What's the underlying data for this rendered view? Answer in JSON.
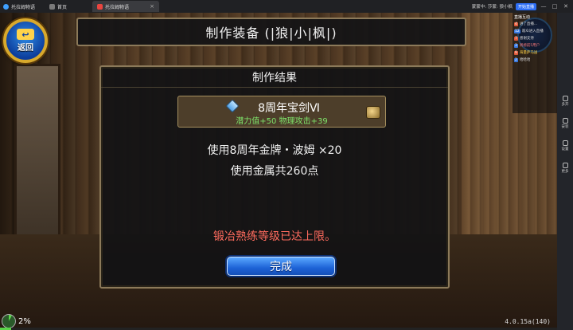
{
  "browser": {
    "app_tab": "托拉姆物语",
    "tabs": [
      {
        "label": "首页"
      },
      {
        "label": "托拉姆物语"
      }
    ],
    "live_label": "蒙蒙中: 莎蒙: 狼小枫",
    "live_pill": "开始直播",
    "win_controls": [
      "—",
      "□",
      "✕"
    ]
  },
  "game": {
    "back_button_label": "返回",
    "title": "制作装备 (|狼|小|枫|)",
    "dialog_title": "制作结果",
    "item": {
      "name": "8周年宝剑Ⅵ",
      "stats": "潜力值+50 物理攻击+39",
      "icon": "sword-icon"
    },
    "material_line": "使用8周年金牌・波姆 ×20",
    "metal_line": "使用金属共260点",
    "warning": "锻冶熟练等级已达上限。",
    "done_button": "完成",
    "progress_pct": "2%",
    "progress_fraction": 0.02,
    "version": "4.0.15a(140)"
  },
  "sidebar": {
    "tools": [
      {
        "label": "多开"
      },
      {
        "label": "安装"
      },
      {
        "label": "设置"
      },
      {
        "label": "更多"
      }
    ]
  },
  "chat": {
    "header": "直播互动",
    "messages": [
      {
        "level": "4",
        "text": "进了直播..."
      },
      {
        "level": "12",
        "text": "观众进入直播"
      },
      {
        "level": "7",
        "text": "感谢支持"
      },
      {
        "level": "3",
        "text": "周榜前5用户"
      },
      {
        "level": "9",
        "text": "海量萨马送"
      },
      {
        "level": "2",
        "text": "哈哈哈"
      }
    ]
  },
  "colors": {
    "warning": "#ff6b5e",
    "stats": "#7ee36a",
    "button_blue": "#1d62d6",
    "frame": "#8c7a5a"
  }
}
